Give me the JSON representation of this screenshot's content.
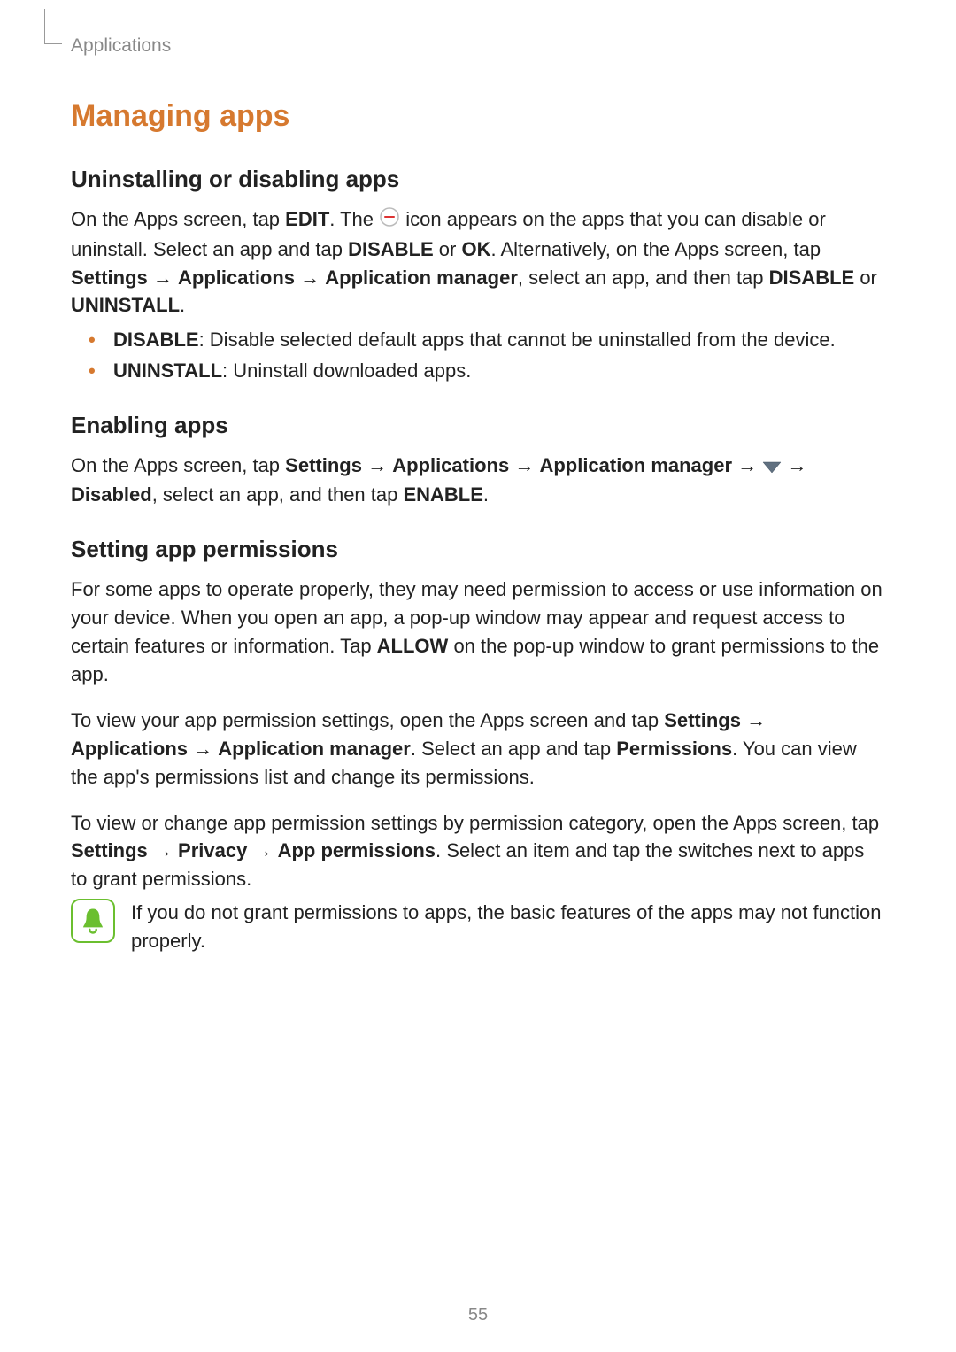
{
  "breadcrumb": "Applications",
  "main_title": "Managing apps",
  "section1": {
    "title": "Uninstalling or disabling apps",
    "p1_a": "On the Apps screen, tap ",
    "p1_edit": "EDIT",
    "p1_b": ". The ",
    "p1_c": " icon appears on the apps that you can disable or uninstall. Select an app and tap ",
    "p1_disable": "DISABLE",
    "p1_or": " or ",
    "p1_ok": "OK",
    "p1_d": ". Alternatively, on the Apps screen, tap ",
    "p1_settings": "Settings",
    "p1_arrow1": " → ",
    "p1_apps": "Applications",
    "p1_arrow2": " → ",
    "p1_mgr": "Application manager",
    "p1_e": ", select an app, and then tap ",
    "p1_disable2": "DISABLE",
    "p1_or2": " or ",
    "p1_uninstall": "UNINSTALL",
    "p1_end": ".",
    "bullet1_label": "DISABLE",
    "bullet1_text": ": Disable selected default apps that cannot be uninstalled from the device.",
    "bullet2_label": "UNINSTALL",
    "bullet2_text": ": Uninstall downloaded apps."
  },
  "section2": {
    "title": "Enabling apps",
    "p1_a": "On the Apps screen, tap ",
    "settings": "Settings",
    "arr1": " → ",
    "apps": "Applications",
    "arr2": " → ",
    "mgr": "Application manager",
    "arr3": " → ",
    "arr4": " → ",
    "disabled": "Disabled",
    "p1_b": ", select an app, and then tap ",
    "enable": "ENABLE",
    "p1_end": "."
  },
  "section3": {
    "title": "Setting app permissions",
    "p1_a": "For some apps to operate properly, they may need permission to access or use information on your device. When you open an app, a pop-up window may appear and request access to certain features or information. Tap ",
    "allow": "ALLOW",
    "p1_b": " on the pop-up window to grant permissions to the app.",
    "p2_a": "To view your app permission settings, open the Apps screen and tap ",
    "settings": "Settings",
    "arr1": " → ",
    "apps": "Applications",
    "arr2": " → ",
    "mgr": "Application manager",
    "p2_b": ". Select an app and tap ",
    "perms": "Permissions",
    "p2_c": ". You can view the app's permissions list and change its permissions.",
    "p3_a": "To view or change app permission settings by permission category, open the Apps screen, tap ",
    "settings2": "Settings",
    "arr3": " → ",
    "privacy": "Privacy",
    "arr4": " → ",
    "app_perms": "App permissions",
    "p3_b": ". Select an item and tap the switches next to apps to grant permissions.",
    "note": "If you do not grant permissions to apps, the basic features of the apps may not function properly."
  },
  "page_num": "55"
}
